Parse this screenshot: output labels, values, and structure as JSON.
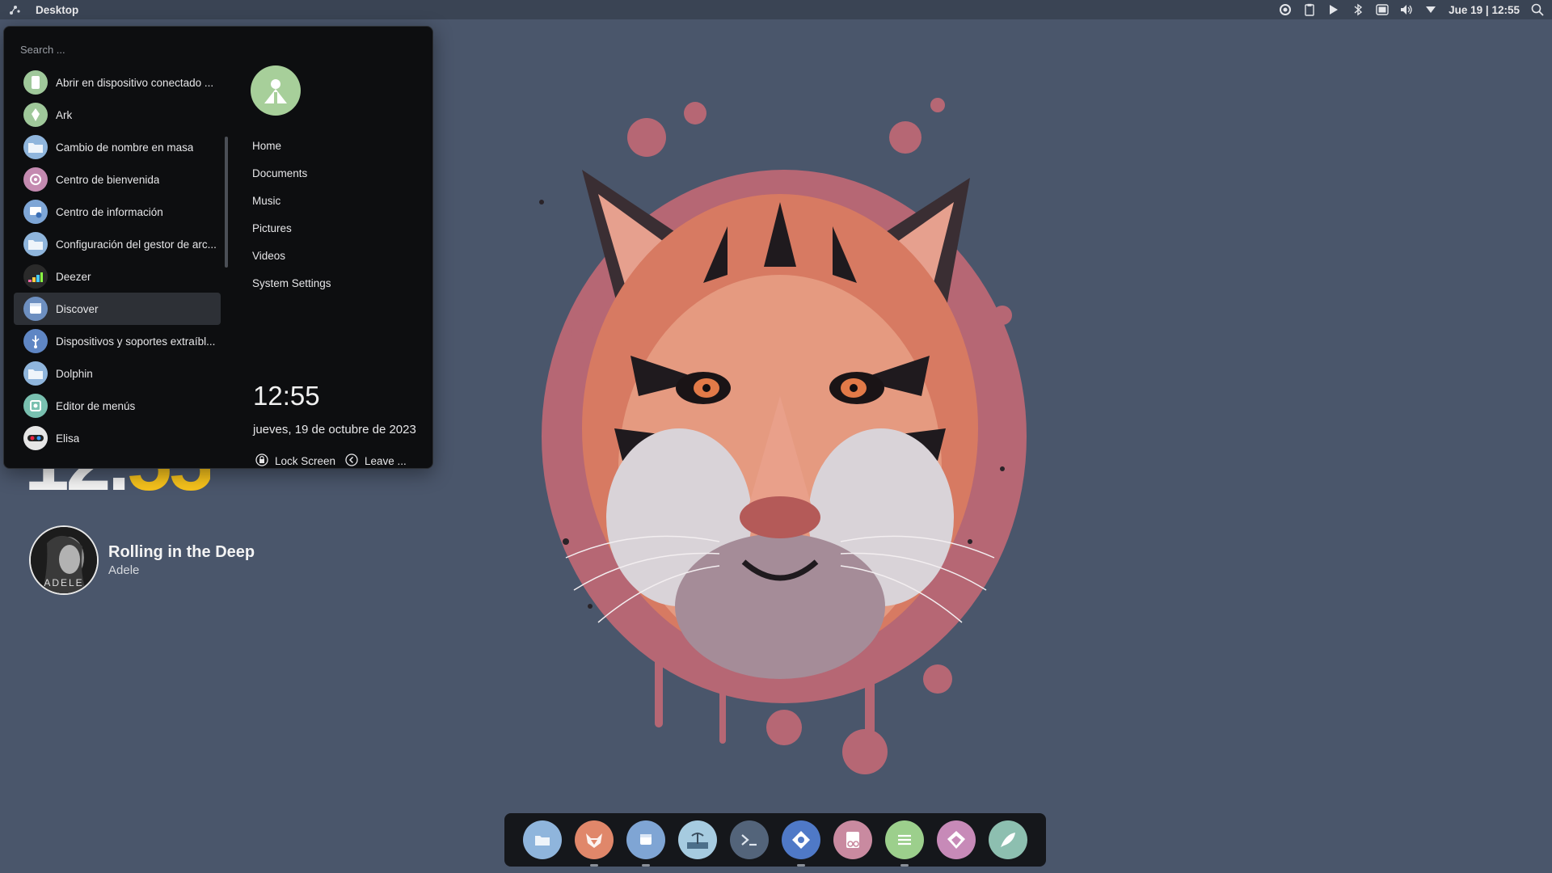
{
  "topbar": {
    "title": "Desktop",
    "clock": "Jue 19 | 12:55",
    "tray_icons": [
      "settings-gear-icon",
      "clipboard-icon",
      "play-icon",
      "bluetooth-icon",
      "battery-icon",
      "volume-icon",
      "network-dropdown-icon",
      "search-icon"
    ]
  },
  "launcher": {
    "search_placeholder": "Search ...",
    "apps": [
      {
        "label": "Abrir en dispositivo conectado ...",
        "icon": "kde-connect-icon",
        "color": "#9fc89a"
      },
      {
        "label": "Ark",
        "icon": "ark-archive-icon",
        "color": "#9fc89a"
      },
      {
        "label": "Cambio de nombre en masa",
        "icon": "folder-icon",
        "color": "#8fb5dc"
      },
      {
        "label": "Centro de bienvenida",
        "icon": "kde-welcome-icon",
        "color": "#c48ab0"
      },
      {
        "label": "Centro de información",
        "icon": "info-center-icon",
        "color": "#7ea6d6"
      },
      {
        "label": "Configuración del gestor de arc...",
        "icon": "folder-icon",
        "color": "#8fb5dc"
      },
      {
        "label": "Deezer",
        "icon": "deezer-icon",
        "color": "#2a2a2a"
      },
      {
        "label": "Discover",
        "icon": "discover-store-icon",
        "color": "#6d8fc0"
      },
      {
        "label": "Dispositivos y soportes extraíbl...",
        "icon": "usb-device-icon",
        "color": "#5f86c4"
      },
      {
        "label": "Dolphin",
        "icon": "dolphin-folder-icon",
        "color": "#8fb5dc"
      },
      {
        "label": "Editor de menús",
        "icon": "menu-editor-icon",
        "color": "#79c0b0"
      },
      {
        "label": "Elisa",
        "icon": "elisa-music-icon",
        "color": "#e6e6e6"
      }
    ],
    "hovered_app": "Discover",
    "places": [
      "Home",
      "Documents",
      "Music",
      "Pictures",
      "Videos",
      "System Settings"
    ],
    "clock": "12:55",
    "date": "jueves, 19 de octubre de 2023",
    "lock_label": "Lock Screen",
    "leave_label": "Leave ..."
  },
  "widget": {
    "clock_hours": "12.",
    "clock_minutes": "55",
    "track_title": "Rolling in the Deep",
    "track_artist": "Adele",
    "album_label": "ADELE"
  },
  "dock": [
    {
      "name": "dock-dolphin",
      "icon": "folder-icon",
      "color": "#8fb5dc",
      "running": false
    },
    {
      "name": "dock-firefox",
      "icon": "firefox-fox-icon",
      "color": "#e0876a",
      "running": true
    },
    {
      "name": "dock-discover",
      "icon": "discover-store-icon",
      "color": "#7fa5d4",
      "running": true
    },
    {
      "name": "dock-wallpaper",
      "icon": "image-viewer-icon",
      "color": "#a6cbe0",
      "running": false
    },
    {
      "name": "dock-konsole",
      "icon": "terminal-icon",
      "color": "#53647a",
      "running": false
    },
    {
      "name": "dock-kate",
      "icon": "diamond-app-icon",
      "color": "#4f79c7",
      "running": true
    },
    {
      "name": "dock-reader",
      "icon": "ebook-reader-icon",
      "color": "#c98aa0",
      "running": false
    },
    {
      "name": "dock-notes",
      "icon": "notes-list-icon",
      "color": "#9ccf8c",
      "running": true
    },
    {
      "name": "dock-krita",
      "icon": "diamond-gem-icon",
      "color": "#c78ab8",
      "running": false
    },
    {
      "name": "dock-feather",
      "icon": "feather-icon",
      "color": "#8dbfb0",
      "running": false
    }
  ]
}
